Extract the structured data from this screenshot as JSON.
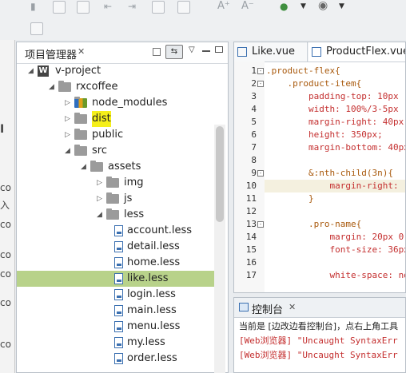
{
  "explorer": {
    "title": "项目管理器",
    "close_glyph": "✕",
    "tree": [
      {
        "label": "v-project",
        "depth": 0,
        "type": "project",
        "expanded": true
      },
      {
        "label": "rxcoffee",
        "depth": 1,
        "type": "folder",
        "expanded": true
      },
      {
        "label": "node_modules",
        "depth": 2,
        "type": "folder-special",
        "expanded": false
      },
      {
        "label": "dist",
        "depth": 2,
        "type": "folder",
        "expanded": false,
        "highlighted": true
      },
      {
        "label": "public",
        "depth": 2,
        "type": "folder",
        "expanded": false
      },
      {
        "label": "src",
        "depth": 2,
        "type": "folder",
        "expanded": true
      },
      {
        "label": "assets",
        "depth": 3,
        "type": "folder",
        "expanded": true
      },
      {
        "label": "img",
        "depth": 4,
        "type": "folder",
        "expanded": false
      },
      {
        "label": "js",
        "depth": 4,
        "type": "folder",
        "expanded": false
      },
      {
        "label": "less",
        "depth": 4,
        "type": "folder",
        "expanded": true
      },
      {
        "label": "account.less",
        "depth": 5,
        "type": "file"
      },
      {
        "label": "detail.less",
        "depth": 5,
        "type": "file"
      },
      {
        "label": "home.less",
        "depth": 5,
        "type": "file"
      },
      {
        "label": "like.less",
        "depth": 5,
        "type": "file",
        "selected": true
      },
      {
        "label": "login.less",
        "depth": 5,
        "type": "file"
      },
      {
        "label": "main.less",
        "depth": 5,
        "type": "file"
      },
      {
        "label": "menu.less",
        "depth": 5,
        "type": "file"
      },
      {
        "label": "my.less",
        "depth": 5,
        "type": "file"
      },
      {
        "label": "order.less",
        "depth": 5,
        "type": "file"
      }
    ]
  },
  "left_strip": {
    "chars": [
      "I",
      "",
      "",
      "co",
      "入",
      "co",
      "co",
      "co",
      "co",
      "co"
    ]
  },
  "editor": {
    "tabs": [
      {
        "label": "Like.vue",
        "active": false
      },
      {
        "label": "ProductFlex.vue",
        "active": true
      }
    ],
    "current_line": 10,
    "lines": [
      {
        "n": "1",
        "fold": "-",
        "code": ".product-flex{",
        "kind": "sel"
      },
      {
        "n": "2",
        "fold": "-",
        "code": "    .product-item{",
        "kind": "sel"
      },
      {
        "n": "3",
        "fold": "",
        "code": "        padding-top: 10px",
        "kind": "prop"
      },
      {
        "n": "4",
        "fold": "",
        "code": "        width: 100%/3-5px",
        "kind": "prop"
      },
      {
        "n": "5",
        "fold": "",
        "code": "        margin-right: 40px",
        "kind": "prop"
      },
      {
        "n": "6",
        "fold": "",
        "code": "        height: 350px;",
        "kind": "prop"
      },
      {
        "n": "7",
        "fold": "",
        "code": "        margin-bottom: 40px",
        "kind": "prop"
      },
      {
        "n": "8",
        "fold": "",
        "code": "",
        "kind": "prop"
      },
      {
        "n": "9",
        "fold": "-",
        "code": "        &:nth-child(3n){",
        "kind": "sel"
      },
      {
        "n": "10",
        "fold": "",
        "code": "            margin-right:",
        "kind": "prop"
      },
      {
        "n": "11",
        "fold": "",
        "code": "        }",
        "kind": "sel"
      },
      {
        "n": "12",
        "fold": "",
        "code": "",
        "kind": "prop"
      },
      {
        "n": "13",
        "fold": "-",
        "code": "        .pro-name{",
        "kind": "sel"
      },
      {
        "n": "14",
        "fold": "",
        "code": "            margin: 20px 0 10p",
        "kind": "prop"
      },
      {
        "n": "15",
        "fold": "",
        "code": "            font-size: 36px;",
        "kind": "prop"
      },
      {
        "n": "16",
        "fold": "",
        "code": "",
        "kind": "prop"
      },
      {
        "n": "17",
        "fold": "",
        "code": "            white-space: nowr",
        "kind": "prop"
      }
    ]
  },
  "console": {
    "title": "控制台",
    "close_glyph": "✕",
    "lines": [
      {
        "text": "当前是 [边改边看控制台]，点右上角工具",
        "color": "#222222"
      },
      {
        "text": "[Web浏览器] \"Uncaught SyntaxErr",
        "color": "#c42f2f"
      },
      {
        "text": "[Web浏览器] \"Uncaught SyntaxErr",
        "color": "#c42f2f"
      }
    ]
  },
  "colors": {
    "selection": "#b8d28a",
    "highlight": "#f5ef1a",
    "code_property": "#c42f2f",
    "code_selector": "#a8580b"
  }
}
